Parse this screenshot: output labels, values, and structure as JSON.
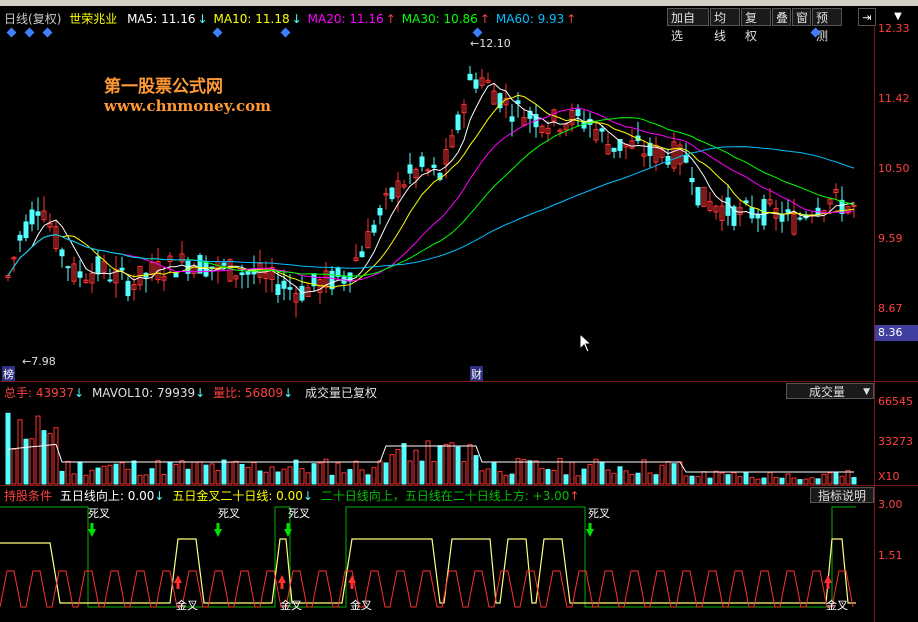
{
  "header": {
    "period": "日线",
    "adjust": "(复权)",
    "stock_name": "世荣兆业",
    "ma": [
      {
        "label": "MA5: 11.16",
        "color": "#ffffff",
        "arrow": "↓"
      },
      {
        "label": "MA10: 11.18",
        "color": "#ffff00",
        "arrow": "↓"
      },
      {
        "label": "MA20: 11.16",
        "color": "#ff00ff",
        "arrow": "↑"
      },
      {
        "label": "MA30: 10.86",
        "color": "#00ff00",
        "arrow": "↑"
      },
      {
        "label": "MA60: 9.93",
        "color": "#00c0ff",
        "arrow": "↑"
      }
    ]
  },
  "toolbar": {
    "buttons": [
      "加自选",
      "均线",
      "复权",
      "叠",
      "窗",
      "预测"
    ]
  },
  "watermark": {
    "line1": "第一股票公式网",
    "line2": "www.chnmoney.com"
  },
  "price_axis": [
    "12.33",
    "11.42",
    "10.50",
    "9.59",
    "8.67",
    "8.36"
  ],
  "price_annotations": {
    "high": "12.10",
    "low": "7.98",
    "badge_left": "榜",
    "badge_mid": "财"
  },
  "volume_header": {
    "total": "总手: 43937",
    "mavol": "MAVOL10: 79939",
    "ratio": "量比: 56809",
    "note": "成交量已复权",
    "dropdown": "成交量"
  },
  "volume_axis": [
    "66545",
    "33273",
    "X10"
  ],
  "indicator_header": {
    "text1": "持股条件",
    "text2": "五日线向上: 0.00",
    "text3": "五日金叉二十日线: 0.00",
    "text4": "二十日线向上，五日线在二十日线上方: +3.00",
    "button": "指标说明"
  },
  "indicator_axis": [
    "3.00",
    "1.51"
  ],
  "signals": {
    "dead": "死叉",
    "golden": "金叉"
  },
  "colors": {
    "up": "#ff3232",
    "down": "#54ffff",
    "ma5": "#ffffff",
    "ma10": "#ffff00",
    "ma20": "#ff00ff",
    "ma30": "#00ff00",
    "ma60": "#00c0ff"
  }
}
